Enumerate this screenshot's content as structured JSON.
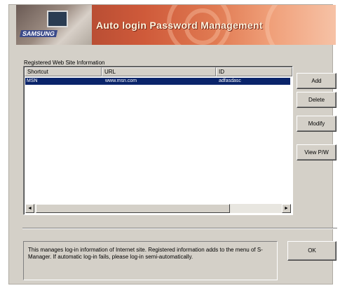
{
  "window": {
    "title": "Auto login Password Management",
    "logo_text": "SAMSUNG"
  },
  "group": {
    "label": "Registered Web Site Information"
  },
  "table": {
    "columns": [
      "Shortcut",
      "URL",
      "ID"
    ],
    "rows": [
      {
        "shortcut": "MSN",
        "url": "www.msn.com",
        "id": "adfasdasc",
        "selected": true
      }
    ]
  },
  "buttons": {
    "add": "Add",
    "delete": "Delete",
    "modify": "Modify",
    "view_pw": "View P/W",
    "ok": "OK"
  },
  "scrollbar": {
    "left_arrow": "◄",
    "right_arrow": "►"
  },
  "info_text": "This manages log-in information of Internet site. Registered information adds to the menu of S-Manager. If automatic log-in fails, please log-in semi-automatically.",
  "colors": {
    "dialog_bg": "#d4d0c8",
    "selection": "#0a246a",
    "banner_accent": "#cf5a3a"
  }
}
